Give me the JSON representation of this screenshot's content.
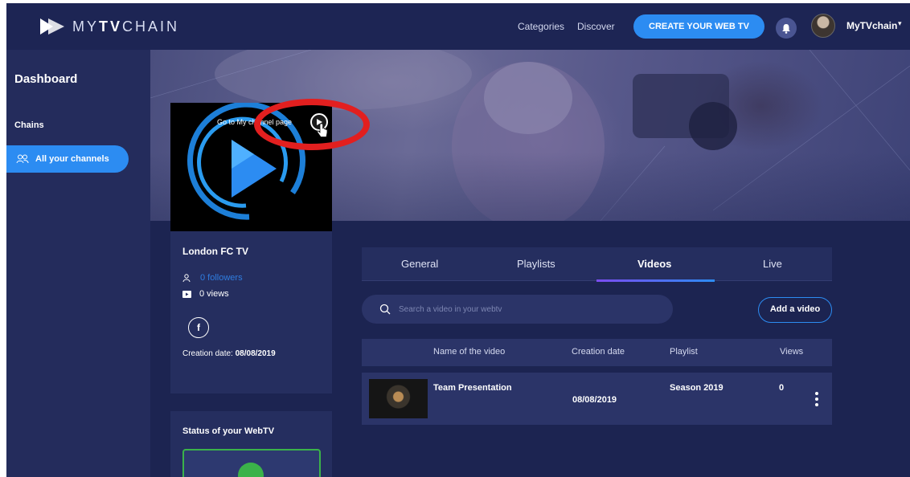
{
  "header": {
    "logo_text_light_1": "MY",
    "logo_text_bold": "TV",
    "logo_text_light_2": "CHAIN",
    "nav": [
      "Categories",
      "Discover"
    ],
    "create_button": "CREATE YOUR WEB TV",
    "user_name": "MyTVchain",
    "caret": "▾"
  },
  "sidebar": {
    "title": "Dashboard",
    "section": "Chains",
    "items": [
      {
        "label": "All your channels",
        "icon": "users-icon",
        "active": true
      }
    ]
  },
  "channel": {
    "goto_label": "Go to My channel page",
    "name": "London FC TV",
    "followers": "0 followers",
    "views": "0 views",
    "facebook_icon_text": "f",
    "creation_date_label": "Creation date:",
    "creation_date": "08/08/2019"
  },
  "status": {
    "title": "Status of your WebTV"
  },
  "tabs": [
    {
      "label": "General",
      "active": false
    },
    {
      "label": "Playlists",
      "active": false
    },
    {
      "label": "Videos",
      "active": true
    },
    {
      "label": "Live",
      "active": false
    }
  ],
  "search": {
    "placeholder": "Search a video in your webtv"
  },
  "add_video_button": "Add a video",
  "table": {
    "columns": [
      "Name of the video",
      "Creation date",
      "Playlist",
      "Views"
    ],
    "rows": [
      {
        "name": "Team Presentation",
        "creation_date": "08/08/2019",
        "playlist": "Season 2019",
        "views": "0"
      }
    ]
  },
  "colors": {
    "background": "#1c2451",
    "accent": "#2c8cf2",
    "highlight_ring": "#e21f1f",
    "status_ok": "#3bb24a"
  }
}
